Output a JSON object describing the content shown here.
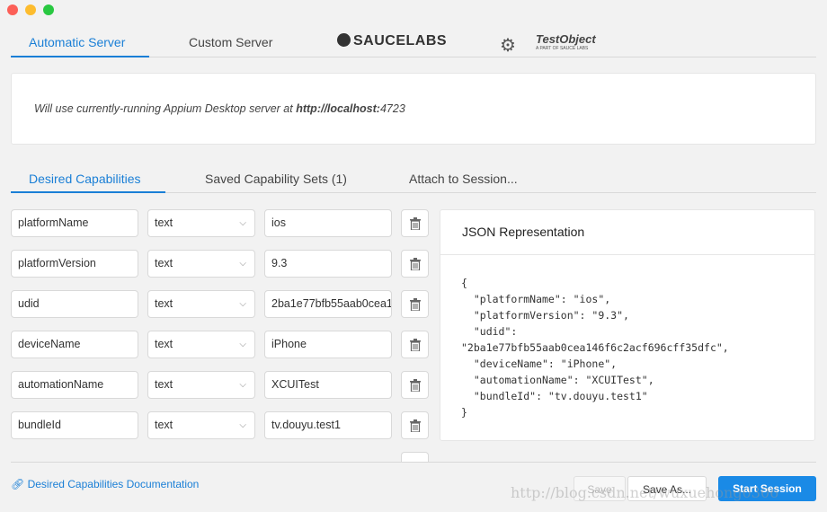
{
  "window": {
    "controls": [
      "close",
      "minimize",
      "zoom"
    ]
  },
  "server_tabs": [
    {
      "label": "Automatic Server",
      "active": true
    },
    {
      "label": "Custom Server",
      "active": false
    }
  ],
  "logos": {
    "saucelabs": "SAUCELABS",
    "testobject": "TestObject",
    "testobject_sub": "A PART OF SAUCE LABS"
  },
  "info": {
    "prefix": "Will use currently-running Appium Desktop server at ",
    "host": "http://localhost:",
    "port": "4723"
  },
  "cap_tabs": [
    {
      "label": "Desired Capabilities",
      "active": true
    },
    {
      "label": "Saved Capability Sets (1)",
      "active": false
    },
    {
      "label": "Attach to Session...",
      "active": false
    }
  ],
  "capabilities": [
    {
      "name": "platformName",
      "type": "text",
      "value": "ios"
    },
    {
      "name": "platformVersion",
      "type": "text",
      "value": "9.3"
    },
    {
      "name": "udid",
      "type": "text",
      "value": "2ba1e77bfb55aab0cea146f6c2acf696cff35dfc"
    },
    {
      "name": "deviceName",
      "type": "text",
      "value": "iPhone"
    },
    {
      "name": "automationName",
      "type": "text",
      "value": "XCUITest"
    },
    {
      "name": "bundleId",
      "type": "text",
      "value": "tv.douyu.test1"
    }
  ],
  "json_panel": {
    "title": "JSON Representation",
    "content": "{\n  \"platformName\": \"ios\",\n  \"platformVersion\": \"9.3\",\n  \"udid\":\n\"2ba1e77bfb55aab0cea146f6c2acf696cff35dfc\",\n  \"deviceName\": \"iPhone\",\n  \"automationName\": \"XCUITest\",\n  \"bundleId\": \"tv.douyu.test1\"\n}"
  },
  "footer": {
    "doc_link": "Desired Capabilities Documentation",
    "save": "Save",
    "save_as": "Save As...",
    "start": "Start Session"
  },
  "watermark": "http://blog.csdn.net/wuxuehong0306",
  "colors": {
    "accent": "#1a7fd6",
    "close": "#fc5f57",
    "minimize": "#fdbc2e",
    "zoom": "#29c841"
  }
}
